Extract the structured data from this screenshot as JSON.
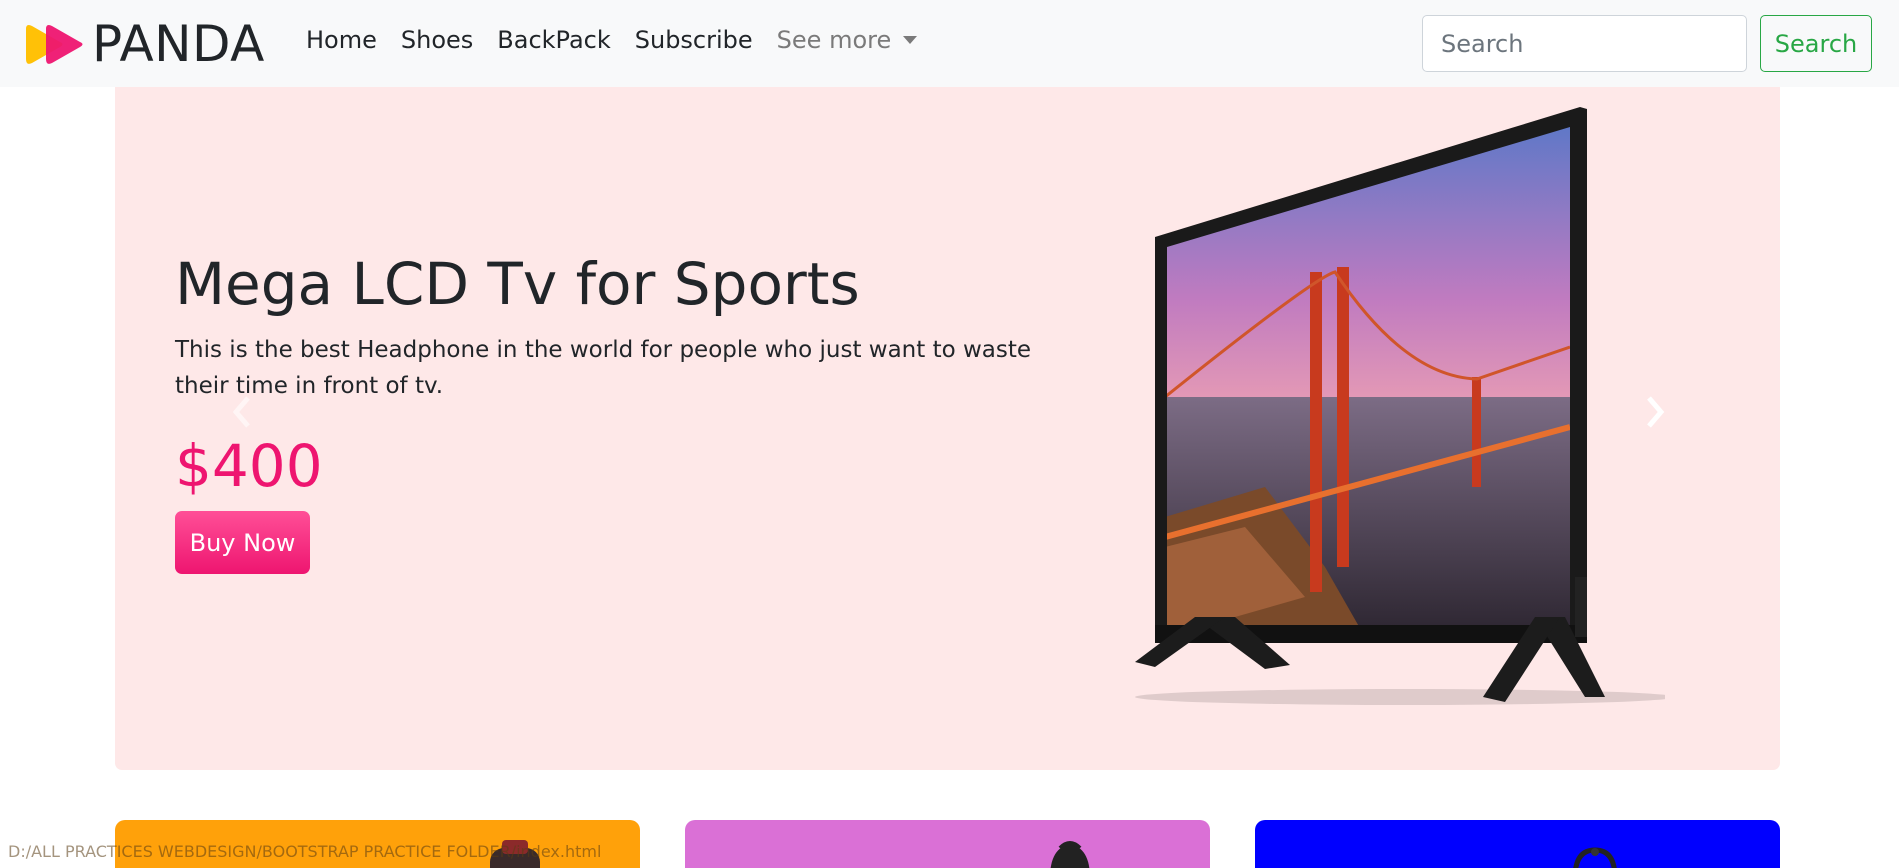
{
  "brand": {
    "name": "PANDA",
    "colors": {
      "logo_front": "#ee1570",
      "logo_back": "#ffc107"
    }
  },
  "nav": {
    "links": [
      "Home",
      "Shoes",
      "BackPack",
      "Subscribe"
    ],
    "dropdown": "See more"
  },
  "search": {
    "placeholder": "Search",
    "button": "Search",
    "accent": "#28a745"
  },
  "hero": {
    "title": "Mega LCD Tv for Sports",
    "description": "This is the best Headphone in the world for people who just want to waste their time in front of tv.",
    "price": "$400",
    "cta": "Buy Now",
    "background": "#fee8e8",
    "price_color": "#ee1570"
  },
  "carousel": {
    "prev_icon": "chevron-left-icon",
    "next_icon": "chevron-right-icon"
  },
  "cards": [
    {
      "color": "#ffa10a",
      "icon": "watch-icon"
    },
    {
      "color": "#da70d6",
      "icon": "backpack-icon"
    },
    {
      "color": "#0000ff",
      "icon": "headphones-icon"
    }
  ],
  "status_bar": {
    "text": "D:/ALL PRACTICES WEBDESIGN/BOOTSTRAP PRACTICE FOLDER/index.html"
  }
}
